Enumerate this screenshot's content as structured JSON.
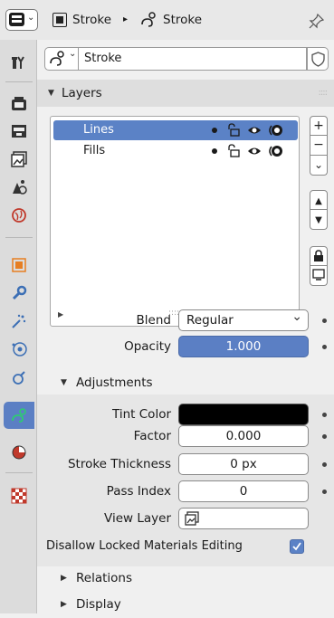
{
  "header": {
    "breadcrumb_object": "Stroke",
    "breadcrumb_data": "Stroke"
  },
  "data_selector": {
    "name": "Stroke"
  },
  "layers_panel": {
    "title": "Layers",
    "layers": [
      {
        "name": "Lines",
        "selected": true
      },
      {
        "name": "Fills",
        "selected": false
      }
    ]
  },
  "properties": {
    "blend_label": "Blend",
    "blend_value": "Regular",
    "opacity_label": "Opacity",
    "opacity_value": "1.000"
  },
  "adjustments": {
    "title": "Adjustments",
    "tint_color_label": "Tint Color",
    "tint_color": "#000000",
    "factor_label": "Factor",
    "factor_value": "0.000",
    "stroke_thickness_label": "Stroke Thickness",
    "stroke_thickness_value": "0 px",
    "pass_index_label": "Pass Index",
    "pass_index_value": "0",
    "view_layer_label": "View Layer",
    "disallow_label": "Disallow Locked Materials Editing",
    "disallow_checked": true
  },
  "subpanels": {
    "relations": "Relations",
    "display": "Display"
  },
  "colors": {
    "accent": "#5b7fc4",
    "selection": "#5b82c6"
  }
}
